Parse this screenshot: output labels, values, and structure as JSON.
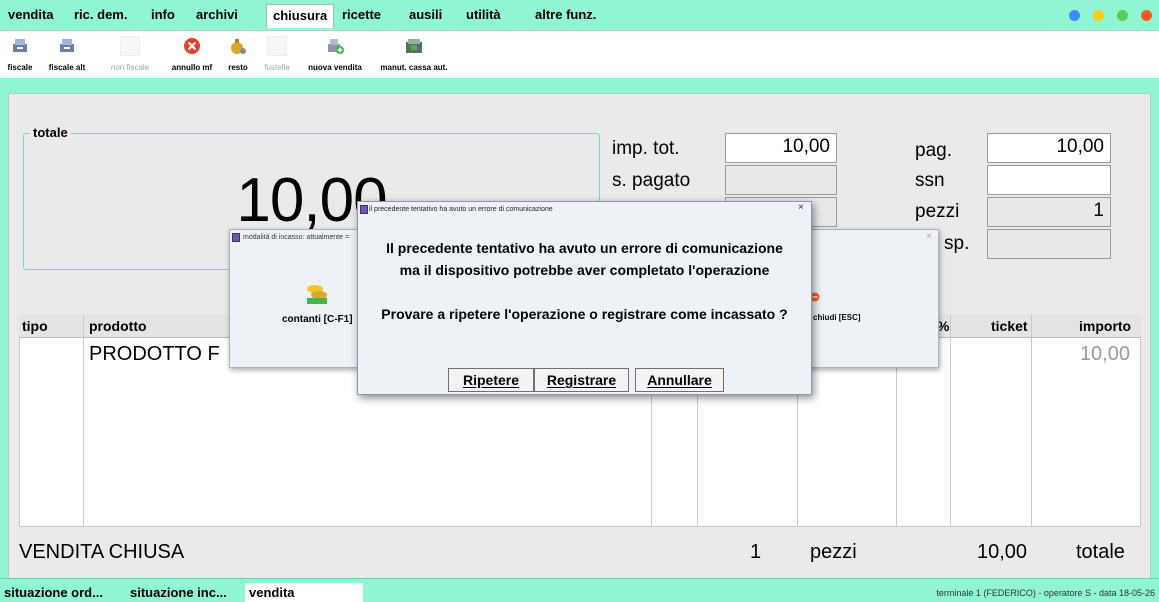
{
  "menu": {
    "items": [
      "vendita",
      "ric. dem.",
      "info",
      "archivi",
      "chiusura",
      "ricette",
      "ausili",
      "utilità",
      "altre funz."
    ],
    "active": "chiusura",
    "window_buttons": [
      "#3d8cff",
      "#ffc81e",
      "#55d054",
      "#ff5a1e"
    ]
  },
  "toolbar": {
    "buttons": [
      {
        "label": "fiscale",
        "icon": "cash-register-icon",
        "enabled": true
      },
      {
        "label": "fiscale alt",
        "icon": "cash-register-alt-icon",
        "enabled": true
      },
      {
        "label": "non fiscale",
        "icon": "blank-icon",
        "enabled": false
      },
      {
        "label": "annullo mf",
        "icon": "cancel-icon",
        "enabled": true
      },
      {
        "label": "resto",
        "icon": "money-bag-icon",
        "enabled": true
      },
      {
        "label": "fustelle",
        "icon": "blank-icon",
        "enabled": false
      },
      {
        "label": "nuova vendita",
        "icon": "new-sale-icon",
        "enabled": true
      },
      {
        "label": "manut. cassa aut.",
        "icon": "cash-machine-icon",
        "enabled": true
      }
    ]
  },
  "totals": {
    "legend": "totale",
    "big_value": "10,00",
    "imp_tot_label": "imp. tot.",
    "imp_tot_value": "10,00",
    "s_pagato_label": "s. pagato",
    "s_pagato_value": "",
    "pag_label": "pag.",
    "pag_value": "10,00",
    "ssn_label": "ssn",
    "ssn_value": "",
    "pezzi_label": "pezzi",
    "pezzi_value": "1",
    "sp_label": "sp.",
    "sp_value": ""
  },
  "table": {
    "headers": {
      "tipo": "tipo",
      "prodotto": "prodotto",
      "percent": "%",
      "ticket": "ticket",
      "importo": "importo"
    },
    "row": {
      "prodotto": "PRODOTTO F",
      "importo": "10,00"
    }
  },
  "footer": {
    "status": "VENDITA CHIUSA",
    "pezzi_count": "1",
    "pezzi_label": "pezzi",
    "total_value": "10,00",
    "total_label": "totale"
  },
  "statusbar": {
    "tabs": [
      "situazione ord...",
      "situazione inc...",
      "vendita"
    ],
    "right_text": "terminale 1 (FEDERICO) - operatore S - data 18-05-26"
  },
  "back_dialog": {
    "title": "modalità di incasso: attualmente =",
    "contanti_label": "contanti [C-F1]",
    "chiudi_label": "chiudi [ESC]",
    "close_glyph": "×"
  },
  "dialog": {
    "title": "il precedente tentativo ha avuto un errore di comunicazione",
    "close_glyph": "×",
    "line1": "Il precedente tentativo ha avuto un errore di comunicazione",
    "line2": "ma il dispositivo potrebbe aver completato l'operazione",
    "line3": "Provare a ripetere l'operazione o registrare come incassato ?",
    "btn_ripetere": "Ripetere",
    "btn_registrare": "Registrare",
    "btn_annullare": "Annullare"
  }
}
